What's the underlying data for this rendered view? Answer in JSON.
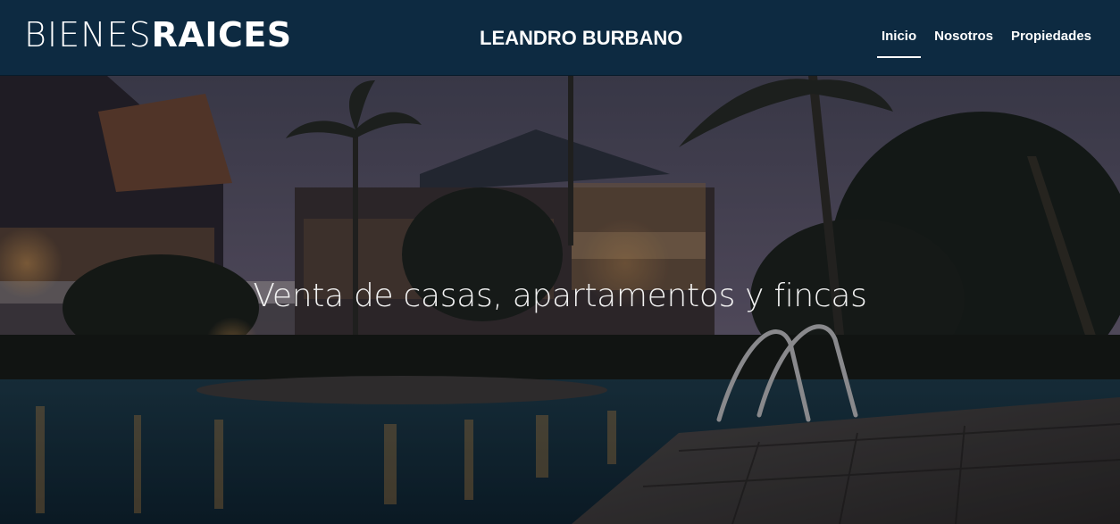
{
  "header": {
    "logo_light": "BIENES",
    "logo_bold": "RAICES",
    "site_name": "LEANDRO BURBANO",
    "nav": [
      {
        "label": "Inicio",
        "active": true
      },
      {
        "label": "Nosotros",
        "active": false
      },
      {
        "label": "Propiedades",
        "active": false
      }
    ]
  },
  "hero": {
    "title": "Venta de casas, apartamentos y fincas",
    "image_subject": "resort-pool-night-photo"
  },
  "colors": {
    "header_bg": "#0d2a41",
    "text": "#ffffff"
  }
}
